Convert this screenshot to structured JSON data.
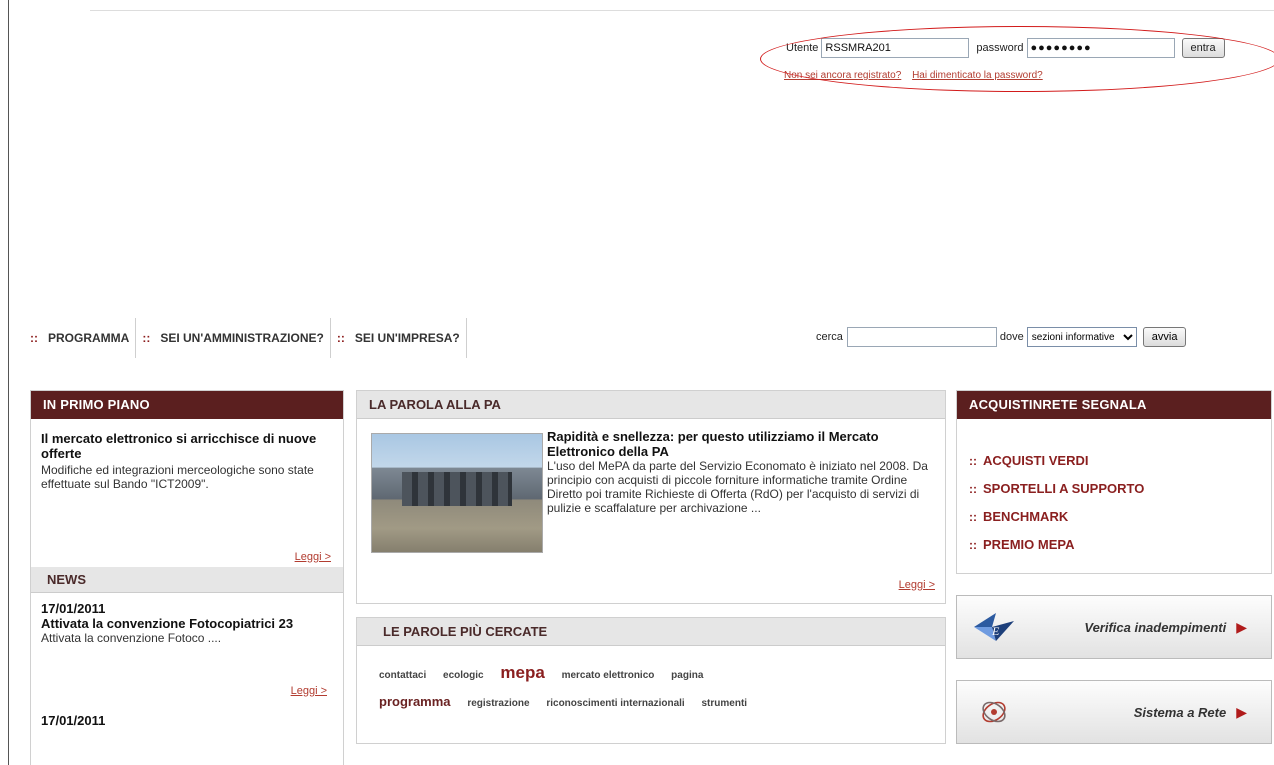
{
  "login": {
    "user_label": "Utente",
    "user_value": "RSSMRA201",
    "password_label": "password",
    "password_value": "●●●●●●●●",
    "submit_label": "entra",
    "register_link": "Non sei ancora registrato?",
    "forgot_link": "Hai dimenticato la password?",
    "highlight_color": "#d21b1b"
  },
  "nav": {
    "items": [
      {
        "label": "PROGRAMMA"
      },
      {
        "label": "SEI UN'AMMINISTRAZIONE?"
      },
      {
        "label": "SEI UN'IMPRESA?"
      }
    ]
  },
  "search": {
    "cerca_label": "cerca",
    "dove_label": "dove",
    "selected_option": "sezioni informative",
    "submit_label": "avvia"
  },
  "primo_piano": {
    "header": "IN PRIMO PIANO",
    "title": "Il mercato elettronico si arricchisce di nuove offerte",
    "text": "Modifiche ed integrazioni merceologiche sono state effettuate sul Bando \"ICT2009\".",
    "more": "Leggi >"
  },
  "news": {
    "header": "NEWS",
    "items": [
      {
        "date": "17/01/2011",
        "title": "Attivata la convenzione Fotocopiatrici 23",
        "text": "Attivata la convenzione Fotoco ....",
        "more": "Leggi >"
      },
      {
        "date": "17/01/2011"
      }
    ]
  },
  "parola_pa": {
    "header": "LA PAROLA ALLA PA",
    "title": "Rapidità e snellezza: per questo utilizziamo il Mercato Elettronico della PA",
    "text": "L'uso del MePA da parte del Servizio Economato è iniziato nel 2008. Da principio con acquisti di piccole forniture informatiche tramite Ordine Diretto poi tramite Richieste di Offerta (RdO) per l'acquisto di servizi di pulizie e scaffalature per archivazione ...",
    "more": "Leggi >"
  },
  "parole_cercate": {
    "header": "LE PAROLE PIÙ CERCATE",
    "row1": [
      "contattaci",
      "ecologic",
      "mepa",
      "mercato elettronico",
      "pagina"
    ],
    "row2": [
      "programma",
      "registrazione",
      "riconoscimenti internazionali",
      "strumenti"
    ]
  },
  "segnala": {
    "header": "ACQUISTINRETE SEGNALA",
    "items": [
      {
        "label": "ACQUISTI VERDI"
      },
      {
        "label": "SPORTELLI A SUPPORTO"
      },
      {
        "label": "BENCHMARK"
      },
      {
        "label": "PREMIO MEPA"
      }
    ]
  },
  "banners": [
    {
      "label": "Verifica inadempimenti",
      "icon": "equitalia-logo-icon"
    },
    {
      "label": "Sistema a Rete",
      "icon": "network-logo-icon"
    }
  ],
  "colors": {
    "brand_dark": "#5b1f1f",
    "link_red": "#b23c30",
    "accent_red": "#8a1f1f"
  }
}
